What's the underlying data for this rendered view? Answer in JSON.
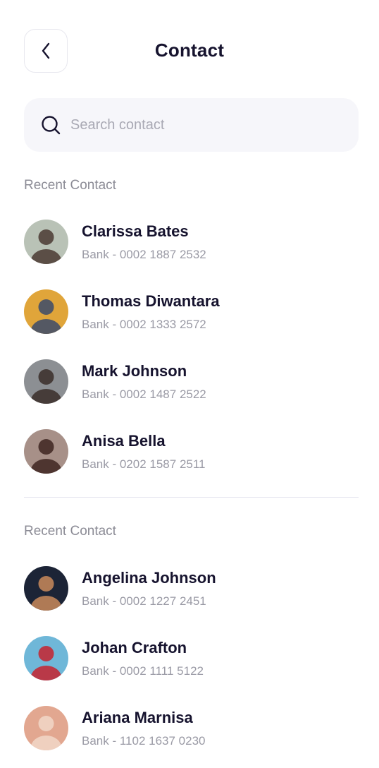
{
  "header": {
    "title": "Contact",
    "back_icon": "chevron-left-icon"
  },
  "search": {
    "placeholder": "Search contact",
    "value": "",
    "icon": "search-icon"
  },
  "sections": [
    {
      "label": "Recent Contact",
      "contacts": [
        {
          "name": "Clarissa Bates",
          "account": "Bank - 0002 1887 2532",
          "avatar_bg": "#b9c2b6",
          "avatar_fg": "#4a3a33"
        },
        {
          "name": "Thomas Diwantara",
          "account": "Bank - 0002 1333 2572",
          "avatar_bg": "#e0a53a",
          "avatar_fg": "#3b4a6b"
        },
        {
          "name": "Mark Johnson",
          "account": "Bank - 0002 1487 2522",
          "avatar_bg": "#8c8f93",
          "avatar_fg": "#3a2e29"
        },
        {
          "name": "Anisa Bella",
          "account": "Bank - 0202 1587 2511",
          "avatar_bg": "#a79088",
          "avatar_fg": "#3e2621"
        }
      ]
    },
    {
      "label": "Recent Contact",
      "contacts": [
        {
          "name": "Angelina Johnson",
          "account": "Bank - 0002 1227 2451",
          "avatar_bg": "#1c2436",
          "avatar_fg": "#c98a5a"
        },
        {
          "name": "Johan Crafton",
          "account": "Bank - 0002 1111 5122",
          "avatar_bg": "#6fb7d8",
          "avatar_fg": "#c7232f"
        },
        {
          "name": "Ariana Marnisa",
          "account": "Bank - 1102 1637 0230",
          "avatar_bg": "#e2a790",
          "avatar_fg": "#f1d7c8"
        }
      ]
    }
  ]
}
